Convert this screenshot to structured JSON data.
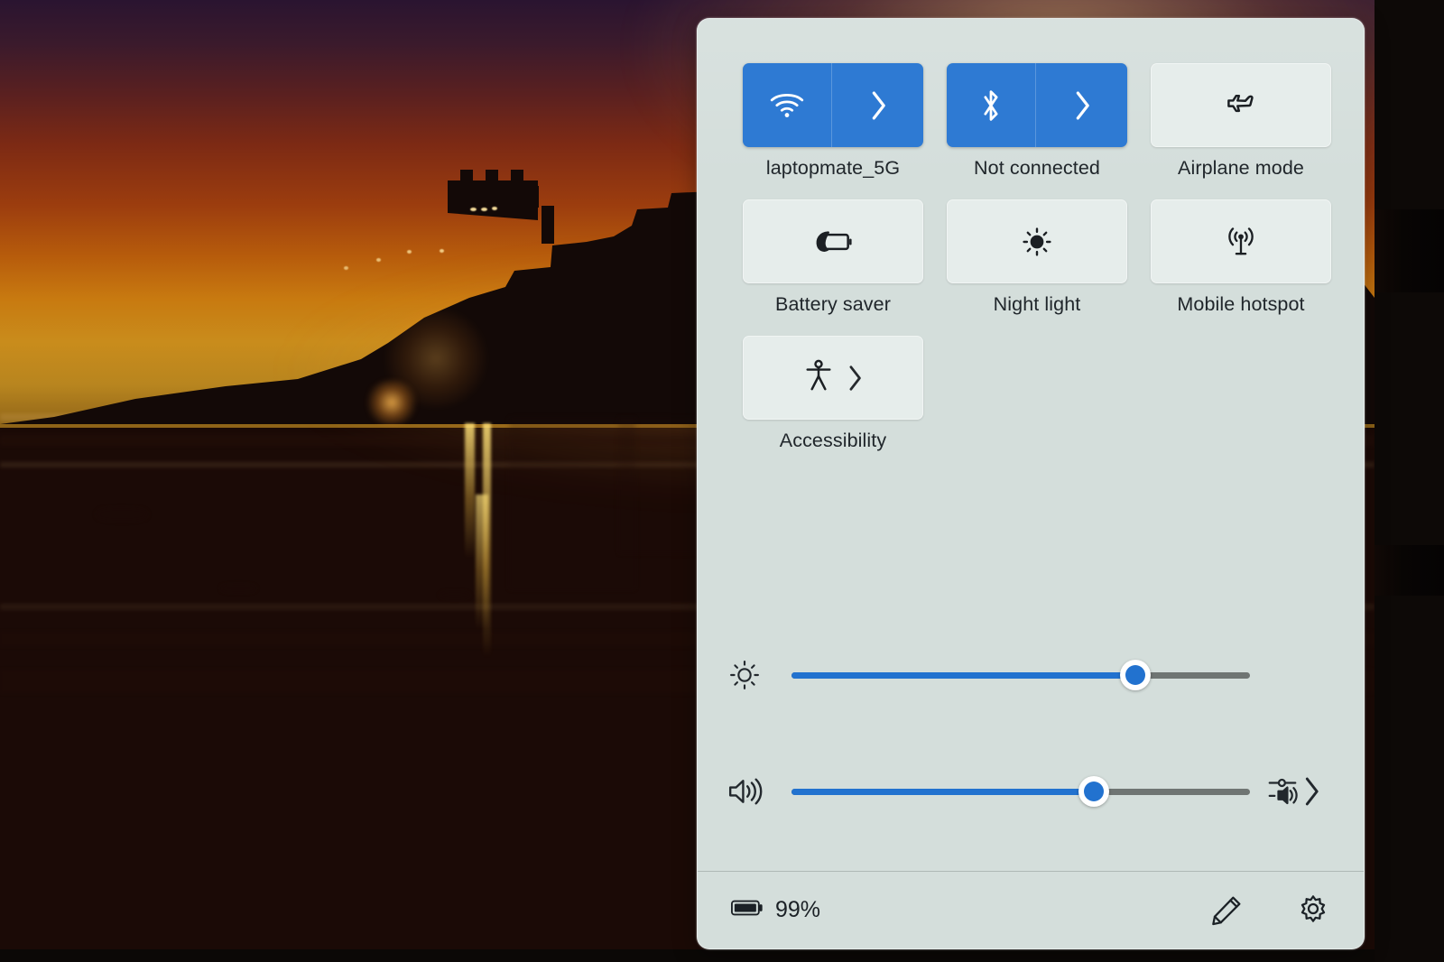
{
  "desktop": {
    "wallpaper_name": "sunset-castle-beach-wallpaper",
    "description": "Castle silhouette at sunset reflected on wet sand"
  },
  "panel": {
    "name": "Windows Quick Settings",
    "background_color": "#d4dedb",
    "accent_color": "#2e7ad3",
    "inactive_tile_color": "#e6edeb"
  },
  "tiles": [
    {
      "id": "wifi",
      "icon": "wifi-icon",
      "label": "laptopmate_5G",
      "state": "on",
      "has_chevron": true,
      "chevron": "chevron-right-icon"
    },
    {
      "id": "bluetooth",
      "icon": "bluetooth-icon",
      "label": "Not connected",
      "state": "on",
      "has_chevron": true,
      "chevron": "chevron-right-icon"
    },
    {
      "id": "airplane-mode",
      "icon": "airplane-icon",
      "label": "Airplane mode",
      "state": "off",
      "has_chevron": false,
      "chevron": ""
    },
    {
      "id": "battery-saver",
      "icon": "battery-saver-icon",
      "label": "Battery saver",
      "state": "off",
      "has_chevron": false,
      "chevron": ""
    },
    {
      "id": "night-light",
      "icon": "brightness-sun-icon",
      "label": "Night light",
      "state": "off",
      "has_chevron": false,
      "chevron": ""
    },
    {
      "id": "mobile-hotspot",
      "icon": "hotspot-icon",
      "label": "Mobile hotspot",
      "state": "off",
      "has_chevron": false,
      "chevron": ""
    },
    {
      "id": "accessibility",
      "icon": "accessibility-person-icon",
      "label": "Accessibility",
      "state": "off",
      "has_chevron": true,
      "chevron": "chevron-right-icon"
    }
  ],
  "sliders": {
    "brightness": {
      "name": "brightness-slider",
      "icon": "brightness-sun-icon",
      "value": 75,
      "min": 0,
      "max": 100,
      "fill_color": "#2272cf",
      "track_color": "#6f7573"
    },
    "volume": {
      "name": "volume-slider",
      "icon": "volume-high-icon",
      "value": 66,
      "min": 0,
      "max": 100,
      "fill_color": "#2272cf",
      "track_color": "#6f7573",
      "output_selector_icon": "audio-output-mixer-icon",
      "output_selector_chevron": "chevron-right-icon"
    }
  },
  "footer": {
    "battery_icon": "battery-full-icon",
    "battery_percent": "99%",
    "edit_icon": "pencil-edit-icon",
    "settings_icon": "gear-settings-icon"
  }
}
